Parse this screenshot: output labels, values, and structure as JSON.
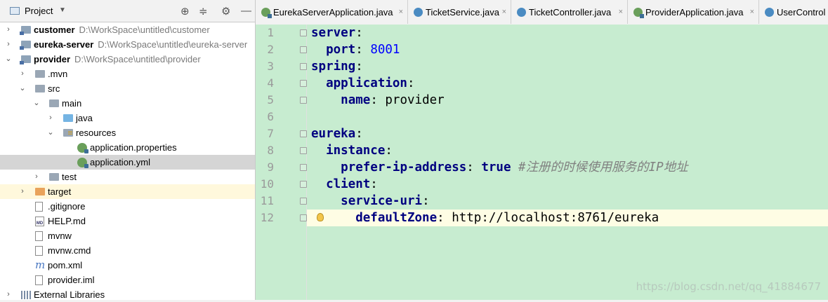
{
  "project_panel": {
    "title": "Project",
    "tree": [
      {
        "label": "customer",
        "path": "D:\\WorkSpace\\untitled\\customer",
        "bold": true,
        "indent": 0,
        "arrow": "›",
        "icon": "module-folder-icon"
      },
      {
        "label": "eureka-server",
        "path": "D:\\WorkSpace\\untitled\\eureka-server",
        "bold": true,
        "indent": 0,
        "arrow": "›",
        "icon": "module-folder-icon"
      },
      {
        "label": "provider",
        "path": "D:\\WorkSpace\\untitled\\provider",
        "bold": true,
        "indent": 0,
        "arrow": "⌄",
        "icon": "module-folder-icon"
      },
      {
        "label": ".mvn",
        "indent": 1,
        "arrow": "›",
        "icon": "folder-icon"
      },
      {
        "label": "src",
        "indent": 1,
        "arrow": "⌄",
        "icon": "folder-icon"
      },
      {
        "label": "main",
        "indent": 2,
        "arrow": "⌄",
        "icon": "folder-icon"
      },
      {
        "label": "java",
        "indent": 3,
        "arrow": "›",
        "icon": "source-folder-icon"
      },
      {
        "label": "resources",
        "indent": 3,
        "arrow": "⌄",
        "icon": "resources-folder-icon"
      },
      {
        "label": "application.properties",
        "indent": 4,
        "arrow": "",
        "icon": "spring-config-icon"
      },
      {
        "label": "application.yml",
        "indent": 4,
        "arrow": "",
        "icon": "spring-config-icon",
        "selected": true
      },
      {
        "label": "test",
        "indent": 2,
        "arrow": "›",
        "icon": "folder-icon"
      },
      {
        "label": "target",
        "indent": 1,
        "arrow": "›",
        "icon": "excluded-folder-icon",
        "highlight": true
      },
      {
        "label": ".gitignore",
        "indent": 1,
        "arrow": "",
        "icon": "file-icon"
      },
      {
        "label": "HELP.md",
        "indent": 1,
        "arrow": "",
        "icon": "markdown-icon"
      },
      {
        "label": "mvnw",
        "indent": 1,
        "arrow": "",
        "icon": "file-icon"
      },
      {
        "label": "mvnw.cmd",
        "indent": 1,
        "arrow": "",
        "icon": "file-icon"
      },
      {
        "label": "pom.xml",
        "indent": 1,
        "arrow": "",
        "icon": "maven-icon"
      },
      {
        "label": "provider.iml",
        "indent": 1,
        "arrow": "",
        "icon": "file-icon"
      },
      {
        "label": "External Libraries",
        "indent": 0,
        "arrow": "›",
        "icon": "library-icon"
      }
    ]
  },
  "tabs": [
    {
      "label": "EurekaServerApplication.java",
      "icon": "spring-boot-class-icon",
      "close": "×"
    },
    {
      "label": "TicketService.java",
      "icon": "class-icon",
      "close": "×"
    },
    {
      "label": "TicketController.java",
      "icon": "class-icon",
      "close": "×"
    },
    {
      "label": "ProviderApplication.java",
      "icon": "spring-boot-class-icon",
      "close": "×"
    },
    {
      "label": "UserControl",
      "icon": "class-icon",
      "close": ""
    }
  ],
  "editor": {
    "file": "application.yml",
    "lines": [
      {
        "num": "1",
        "indent": "",
        "key": "server",
        "sep": ":",
        "value": "",
        "value_type": "",
        "comment": "",
        "fold": true
      },
      {
        "num": "2",
        "indent": "  ",
        "key": "port",
        "sep": ": ",
        "value": "8001",
        "value_type": "n",
        "comment": "",
        "fold": true
      },
      {
        "num": "3",
        "indent": "",
        "key": "spring",
        "sep": ":",
        "value": "",
        "value_type": "",
        "comment": "",
        "fold": true
      },
      {
        "num": "4",
        "indent": "  ",
        "key": "application",
        "sep": ":",
        "value": "",
        "value_type": "",
        "comment": "",
        "fold": true
      },
      {
        "num": "5",
        "indent": "    ",
        "key": "name",
        "sep": ": ",
        "value": "provider",
        "value_type": "v",
        "comment": "",
        "fold": true
      },
      {
        "num": "6",
        "indent": "",
        "key": "",
        "sep": "",
        "value": "",
        "value_type": "",
        "comment": "",
        "fold": false
      },
      {
        "num": "7",
        "indent": "",
        "key": "eureka",
        "sep": ":",
        "value": "",
        "value_type": "",
        "comment": "",
        "fold": true
      },
      {
        "num": "8",
        "indent": "  ",
        "key": "instance",
        "sep": ":",
        "value": "",
        "value_type": "",
        "comment": "",
        "fold": true
      },
      {
        "num": "9",
        "indent": "    ",
        "key": "prefer-ip-address",
        "sep": ": ",
        "value": "true",
        "value_type": "b",
        "comment": " #注册的时候使用服务的IP地址",
        "fold": true
      },
      {
        "num": "10",
        "indent": "  ",
        "key": "client",
        "sep": ":",
        "value": "",
        "value_type": "",
        "comment": "",
        "fold": true
      },
      {
        "num": "11",
        "indent": "    ",
        "key": "service-uri",
        "sep": ":",
        "value": "",
        "value_type": "",
        "comment": "",
        "fold": true
      },
      {
        "num": "12",
        "indent": "      ",
        "key": "defaultZone",
        "sep": ": ",
        "value": "http://localhost:8761/eureka",
        "value_type": "v",
        "comment": "",
        "fold": true,
        "current": true
      }
    ]
  },
  "watermark": "https://blog.csdn.net/qq_41884677",
  "colors": {
    "editor_bg": "#c7ecd0",
    "current_line": "#fefde4",
    "keyword": "#000080",
    "number": "#0000ff",
    "comment": "#808080"
  }
}
